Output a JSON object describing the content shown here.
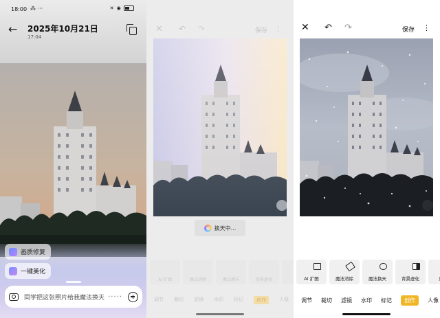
{
  "status_bar": {
    "time": "18:00",
    "dots": "⁂ ···"
  },
  "gallery_view": {
    "date": "2025年10月21日",
    "time": "17:04",
    "chips": [
      {
        "label": "画质修复"
      },
      {
        "label": "一键美化"
      }
    ],
    "input": {
      "text": "同学把这张照片给我魔法换天",
      "more": "·····"
    }
  },
  "editor_processing": {
    "save_label": "保存",
    "status_label": "换天中...",
    "tools": [
      "AI 扩图",
      "魔法消除",
      "魔法换天",
      "背景虚化",
      "魔"
    ],
    "tabs": [
      "调节",
      "裁切",
      "滤镜",
      "水印",
      "标记",
      "创作",
      "人像"
    ],
    "active_tab": "创作"
  },
  "editor_result": {
    "save_label": "保存",
    "tools": [
      {
        "label": "AI 扩图",
        "icon": "expand-icon"
      },
      {
        "label": "魔法消除",
        "icon": "eraser-icon"
      },
      {
        "label": "魔法换天",
        "icon": "cloud-icon"
      },
      {
        "label": "背景虚化",
        "icon": "blur-icon"
      },
      {
        "label": "魔法",
        "icon": "magic-icon"
      }
    ],
    "tabs": [
      "调节",
      "裁切",
      "滤镜",
      "水印",
      "标记"
    ],
    "active_tab": "创作",
    "trailing_tab": "人像"
  },
  "colors": {
    "accent": "#f0b625",
    "sunset_sky_top": "#b9b3b0",
    "sunset_sky_bottom": "#d1a888",
    "snow_sky": "#a9afbb"
  }
}
